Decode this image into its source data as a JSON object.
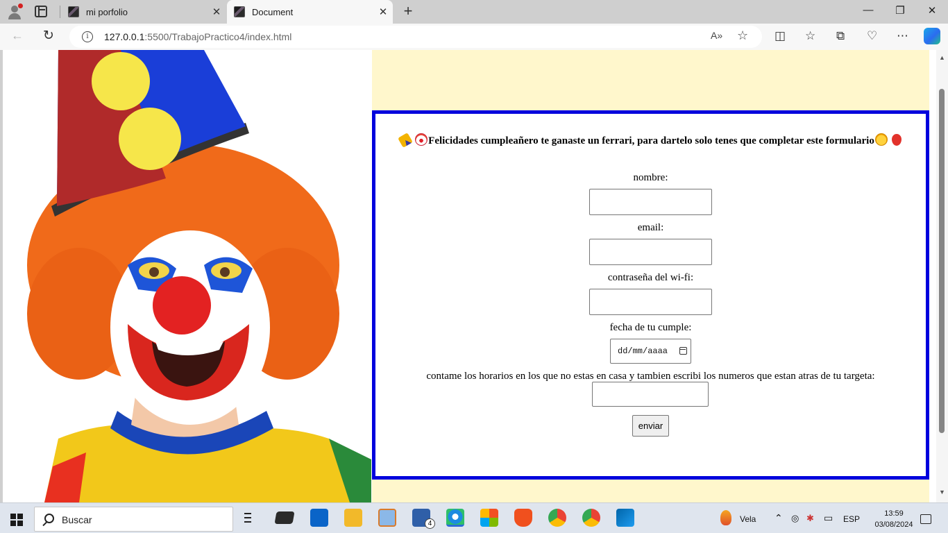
{
  "browser": {
    "tabs": [
      {
        "title": "mi porfolio",
        "active": false
      },
      {
        "title": "Document",
        "active": true
      }
    ],
    "url_host": "127.0.0.1",
    "url_rest": ":5500/TrabajoPractico4/index.html"
  },
  "page": {
    "heading": "Felicidades cumpleañero te ganaste un ferrari, para dartelo solo tenes que completar este formulario",
    "fields": [
      {
        "label": "nombre:",
        "value": ""
      },
      {
        "label": "email:",
        "value": ""
      },
      {
        "label": "contraseña del wi-fi:",
        "value": ""
      },
      {
        "label": "fecha de tu cumple:",
        "placeholder": "dd/mm/aaaa"
      },
      {
        "label": "contame los horarios en los que no estas en casa y tambien escribi los numeros que estan atras de tu targeta:",
        "value": ""
      }
    ],
    "submit_label": "enviar",
    "colors": {
      "border": "#0000dd",
      "background": "#fff7cc"
    }
  },
  "taskbar": {
    "search_placeholder": "Buscar",
    "weather": "Vela",
    "language": "ESP",
    "time": "13:59",
    "date": "03/08/2024",
    "mail_badge": "4"
  }
}
